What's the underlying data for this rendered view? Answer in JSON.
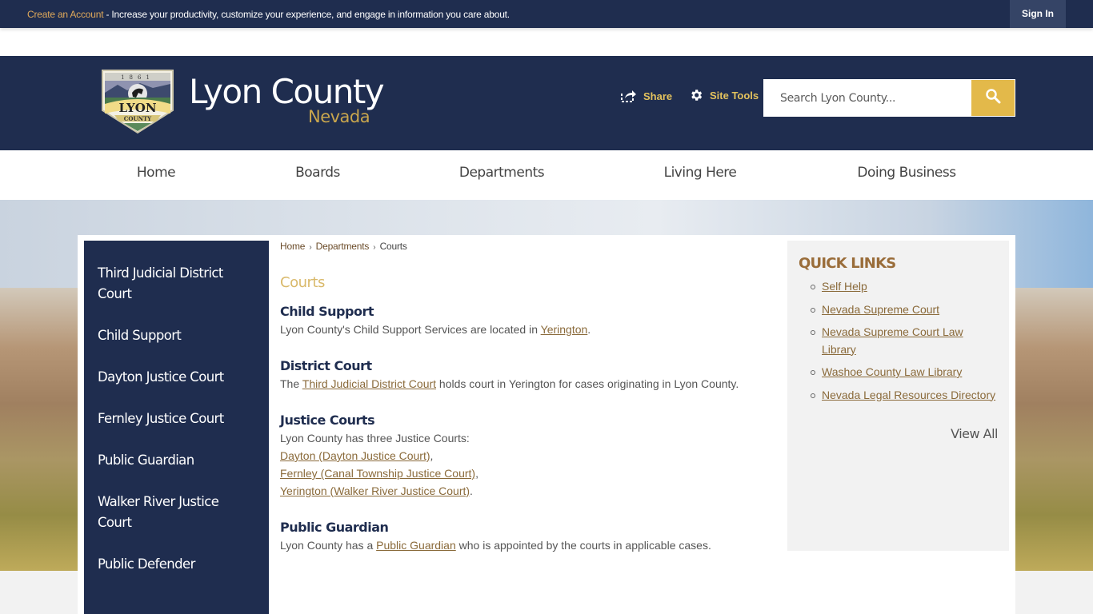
{
  "topbar": {
    "create_account": "Create an Account",
    "message": " - Increase your productivity, customize your experience, and engage in information you care about.",
    "sign_in": "Sign In"
  },
  "header": {
    "title": "Lyon County",
    "subtitle": "Nevada",
    "logo_alt": "Lyon County seal",
    "share_label": "Share",
    "site_tools_label": "Site Tools",
    "search_placeholder": "Search Lyon County...",
    "colors": {
      "navy": "#1f2d4f",
      "gold": "#e3b94a"
    }
  },
  "nav": {
    "items": [
      {
        "label": "Home"
      },
      {
        "label": "Boards"
      },
      {
        "label": "Departments"
      },
      {
        "label": "Living Here"
      },
      {
        "label": "Doing Business"
      }
    ]
  },
  "sidebar": {
    "items": [
      {
        "label": "Third Judicial District Court"
      },
      {
        "label": "Child Support"
      },
      {
        "label": "Dayton Justice Court"
      },
      {
        "label": "Fernley Justice Court"
      },
      {
        "label": "Public Guardian"
      },
      {
        "label": "Walker River Justice Court"
      },
      {
        "label": "Public Defender"
      }
    ]
  },
  "breadcrumb": {
    "items": [
      "Home",
      "Departments",
      "Courts"
    ],
    "separator": "›"
  },
  "main": {
    "title": "Courts",
    "child_support": {
      "heading": "Child Support",
      "text_before": "Lyon County's Child Support Services are located in ",
      "link": "Yerington",
      "text_after": "."
    },
    "district_court": {
      "heading": "District Court",
      "text_before": "The ",
      "link": "Third Judicial District Court",
      "text_after": " holds court in Yerington for cases originating in Lyon County."
    },
    "justice_courts": {
      "heading": "Justice Courts",
      "intro": "Lyon County has three Justice Courts:",
      "links": [
        {
          "label": "Dayton (Dayton Justice Court)",
          "suffix": ","
        },
        {
          "label": "Fernley (Canal Township Justice Court)",
          "suffix": ","
        },
        {
          "label": "Yerington (Walker River Justice Court)",
          "suffix": "."
        }
      ]
    },
    "public_guardian": {
      "heading": "Public Guardian",
      "text_before": "Lyon County has a ",
      "link": "Public Guardian",
      "text_after": " who is appointed by the courts in applicable cases."
    }
  },
  "quick_links": {
    "title": "QUICK LINKS",
    "items": [
      {
        "label": "Self Help"
      },
      {
        "label": "Nevada Supreme Court"
      },
      {
        "label": "Nevada Supreme Court Law Library"
      },
      {
        "label": "Washoe County Law Library"
      },
      {
        "label": "Nevada Legal Resources Directory"
      }
    ],
    "view_all": "View All"
  }
}
